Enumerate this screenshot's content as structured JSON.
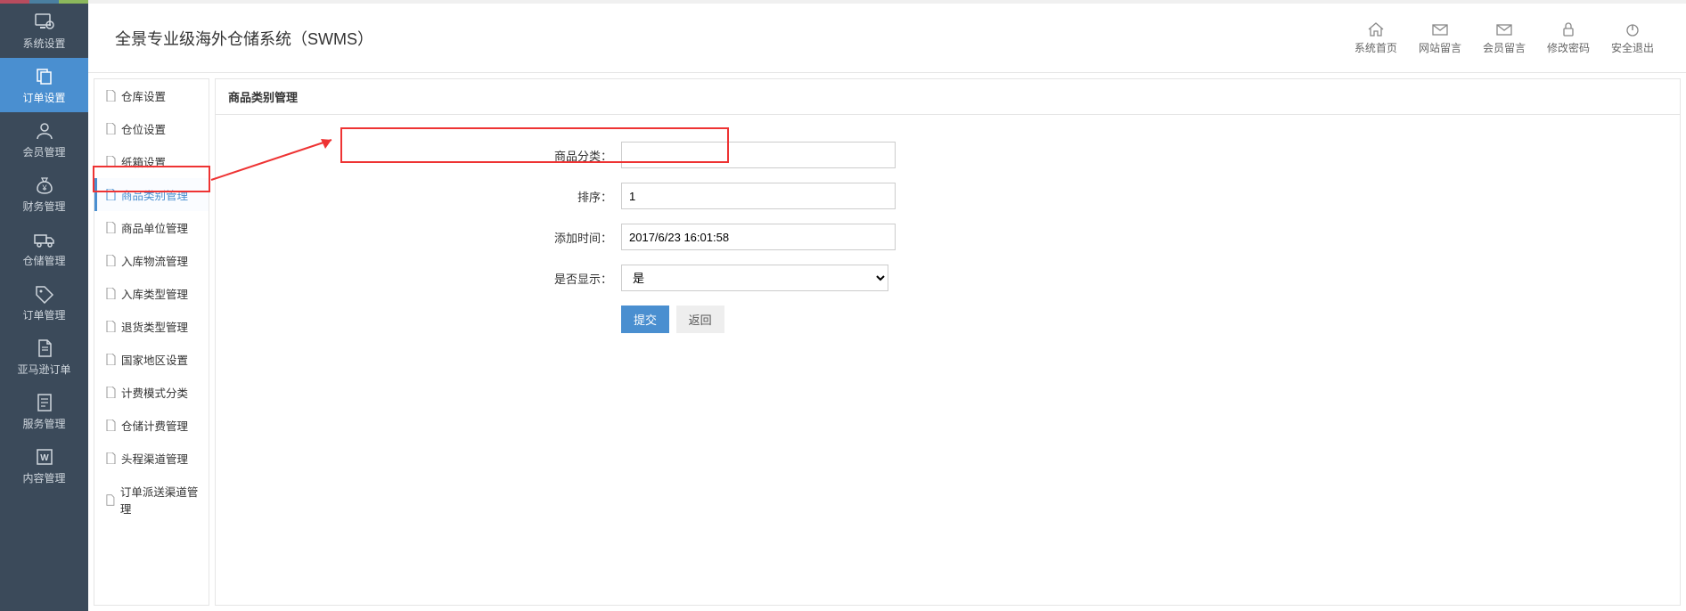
{
  "header": {
    "title": "全景专业级海外仓储系统（SWMS）",
    "tools": [
      {
        "label": "系统首页"
      },
      {
        "label": "网站留言"
      },
      {
        "label": "会员留言"
      },
      {
        "label": "修改密码"
      },
      {
        "label": "安全退出"
      }
    ]
  },
  "nav": [
    {
      "label": "系统设置",
      "icon": "gear"
    },
    {
      "label": "订单设置",
      "icon": "copy",
      "active": true
    },
    {
      "label": "会员管理",
      "icon": "users"
    },
    {
      "label": "财务管理",
      "icon": "moneybag"
    },
    {
      "label": "仓储管理",
      "icon": "truck"
    },
    {
      "label": "订单管理",
      "icon": "tag"
    },
    {
      "label": "亚马逊订单",
      "icon": "doc"
    },
    {
      "label": "服务管理",
      "icon": "page"
    },
    {
      "label": "内容管理",
      "icon": "word"
    }
  ],
  "subnav": [
    {
      "label": "仓库设置"
    },
    {
      "label": "仓位设置"
    },
    {
      "label": "纸箱设置"
    },
    {
      "label": "商品类别管理",
      "active": true
    },
    {
      "label": "商品单位管理"
    },
    {
      "label": "入库物流管理"
    },
    {
      "label": "入库类型管理"
    },
    {
      "label": "退货类型管理"
    },
    {
      "label": "国家地区设置"
    },
    {
      "label": "计费模式分类"
    },
    {
      "label": "仓储计费管理"
    },
    {
      "label": "头程渠道管理"
    },
    {
      "label": "订单派送渠道管理"
    }
  ],
  "content": {
    "title": "商品类别管理",
    "fields": {
      "category_label": "商品分类：",
      "category_value": "",
      "sort_label": "排序：",
      "sort_value": "1",
      "addtime_label": "添加时间：",
      "addtime_value": "2017/6/23 16:01:58",
      "show_label": "是否显示：",
      "show_value": "是"
    },
    "buttons": {
      "submit": "提交",
      "back": "返回"
    }
  }
}
